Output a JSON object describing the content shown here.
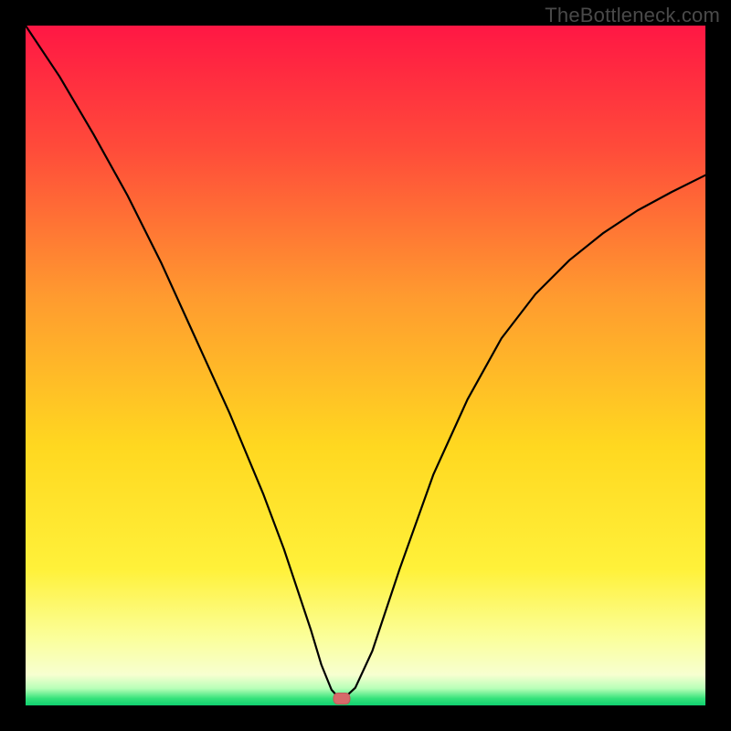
{
  "watermark": "TheBottleneck.com",
  "chart_data": {
    "type": "line",
    "title": "",
    "xlabel": "",
    "ylabel": "",
    "xlim": [
      0,
      100
    ],
    "ylim": [
      0,
      100
    ],
    "grid": false,
    "legend": false,
    "background_gradient": {
      "stops": [
        {
          "offset": 0.0,
          "color": "#ff1744"
        },
        {
          "offset": 0.18,
          "color": "#ff4b3a"
        },
        {
          "offset": 0.4,
          "color": "#ff9b2f"
        },
        {
          "offset": 0.62,
          "color": "#ffd820"
        },
        {
          "offset": 0.8,
          "color": "#fff13a"
        },
        {
          "offset": 0.9,
          "color": "#fbff9a"
        },
        {
          "offset": 0.955,
          "color": "#f7ffd0"
        },
        {
          "offset": 0.975,
          "color": "#b8ffb8"
        },
        {
          "offset": 0.99,
          "color": "#34e27a"
        },
        {
          "offset": 1.0,
          "color": "#10d070"
        }
      ]
    },
    "series": [
      {
        "name": "bottleneck-curve",
        "x": [
          0,
          5,
          10,
          15,
          20,
          25,
          30,
          35,
          38,
          40,
          42,
          43.5,
          45,
          46,
          47,
          48.5,
          51,
          55,
          60,
          65,
          70,
          75,
          80,
          85,
          90,
          95,
          100
        ],
        "y": [
          100,
          92.5,
          84,
          75,
          65,
          54,
          43,
          31,
          23,
          17,
          11,
          6,
          2.3,
          1.2,
          1.2,
          2.6,
          8,
          20,
          34,
          45,
          54,
          60.5,
          65.5,
          69.5,
          72.8,
          75.5,
          78
        ]
      }
    ],
    "min_marker": {
      "x": 46.5,
      "y": 1.0,
      "color": "#d66a6a"
    }
  }
}
